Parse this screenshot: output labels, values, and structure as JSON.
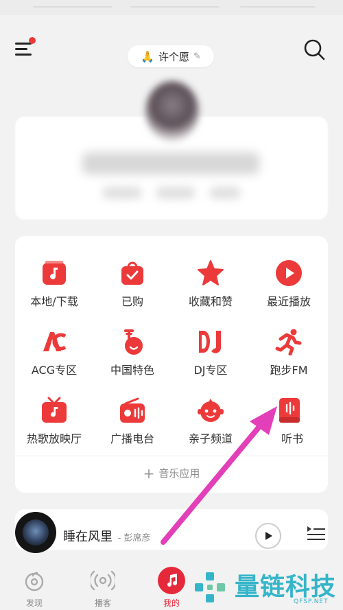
{
  "header": {
    "wish_label": "许个愿",
    "wish_emoji": "🙏",
    "wish_edit_icon": "pencil-icon",
    "menu_icon": "menu-icon",
    "search_icon": "search-icon"
  },
  "grid": {
    "items": [
      {
        "label": "本地/下载",
        "icon": "local-download-icon"
      },
      {
        "label": "已购",
        "icon": "purchased-bag-icon"
      },
      {
        "label": "收藏和赞",
        "icon": "star-icon"
      },
      {
        "label": "最近播放",
        "icon": "recent-play-icon"
      },
      {
        "label": "ACG专区",
        "icon": "acg-icon"
      },
      {
        "label": "中国特色",
        "icon": "pipa-icon"
      },
      {
        "label": "DJ专区",
        "icon": "dj-icon"
      },
      {
        "label": "跑步FM",
        "icon": "running-icon"
      },
      {
        "label": "热歌放映厅",
        "icon": "tv-icon"
      },
      {
        "label": "广播电台",
        "icon": "radio-icon"
      },
      {
        "label": "亲子频道",
        "icon": "kids-icon"
      },
      {
        "label": "听书",
        "icon": "audiobook-icon"
      }
    ],
    "add_label": "音乐应用"
  },
  "player": {
    "song": "睡在风里",
    "artist": "- 彭席彦"
  },
  "tabs": [
    {
      "label": "发现",
      "icon": "discover-icon"
    },
    {
      "label": "播客",
      "icon": "podcast-icon"
    },
    {
      "label": "我的",
      "icon": "music-note-icon",
      "active": true
    }
  ],
  "watermark": {
    "title": "量链科技",
    "sub": "QFSP.NET"
  },
  "colors": {
    "accent": "#e6293a",
    "icon_red": "#ec3a3a",
    "arrow": "#e23fb8",
    "watermark": "#35b5c9"
  }
}
